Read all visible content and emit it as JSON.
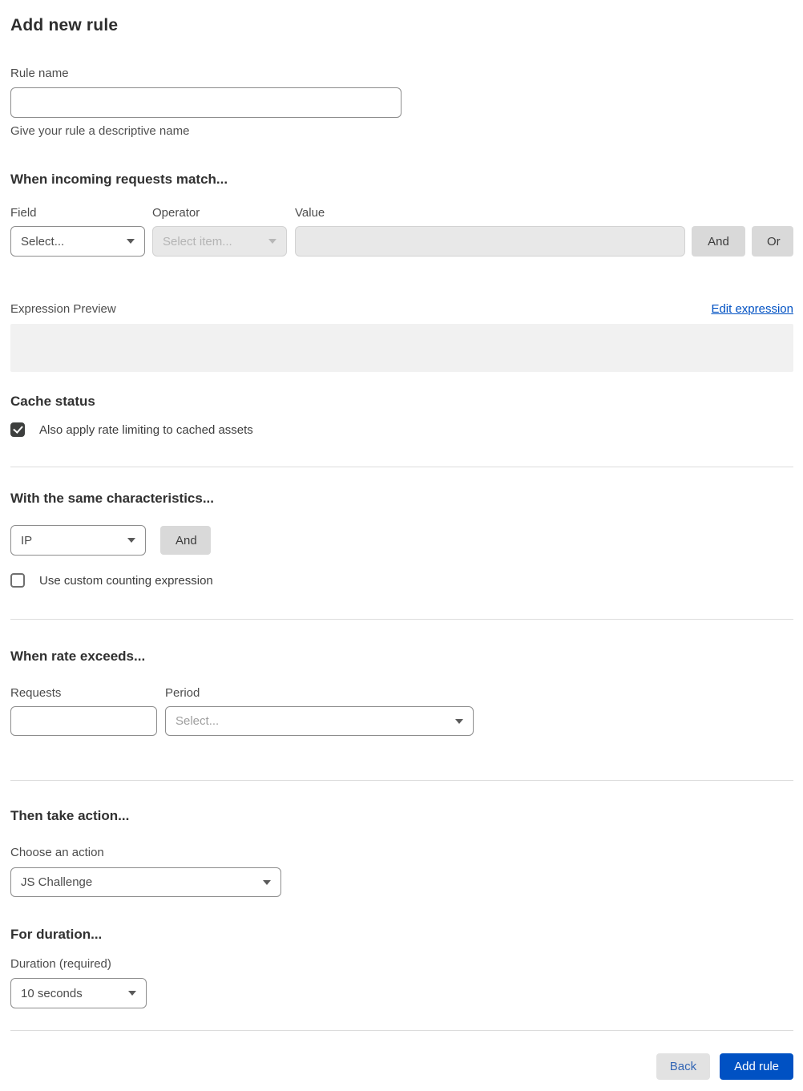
{
  "page": {
    "title": "Add new rule"
  },
  "colors": {
    "accent_blue": "#0051c3",
    "link_blue": "#0051c3",
    "button_grey": "#d9d9d9",
    "checkbox_checked": "#3d3f3e",
    "preview_bg": "#f1f1f1"
  },
  "rule_name": {
    "label": "Rule name",
    "value": "",
    "helper": "Give your rule a descriptive name"
  },
  "match": {
    "heading": "When incoming requests match...",
    "field": {
      "label": "Field",
      "value": "Select..."
    },
    "operator": {
      "label": "Operator",
      "value": "Select item...",
      "disabled": true
    },
    "value_input": {
      "label": "Value",
      "value": "",
      "disabled": true
    },
    "and_label": "And",
    "or_label": "Or"
  },
  "expression": {
    "label": "Expression Preview",
    "edit_link": "Edit expression",
    "value": ""
  },
  "cache": {
    "heading": "Cache status",
    "checkbox_label": "Also apply rate limiting to cached assets",
    "checked": true
  },
  "characteristics": {
    "heading": "With the same characteristics...",
    "select_value": "IP",
    "and_label": "And",
    "checkbox_label": "Use custom counting expression",
    "checked": false
  },
  "rate": {
    "heading": "When rate exceeds...",
    "requests": {
      "label": "Requests",
      "value": ""
    },
    "period": {
      "label": "Period",
      "value": "Select...",
      "is_placeholder": true
    }
  },
  "action": {
    "heading": "Then take action...",
    "label": "Choose an action",
    "value": "JS Challenge"
  },
  "duration": {
    "heading": "For duration...",
    "label": "Duration (required)",
    "value": "10 seconds"
  },
  "footer": {
    "back_label": "Back",
    "submit_label": "Add rule"
  }
}
